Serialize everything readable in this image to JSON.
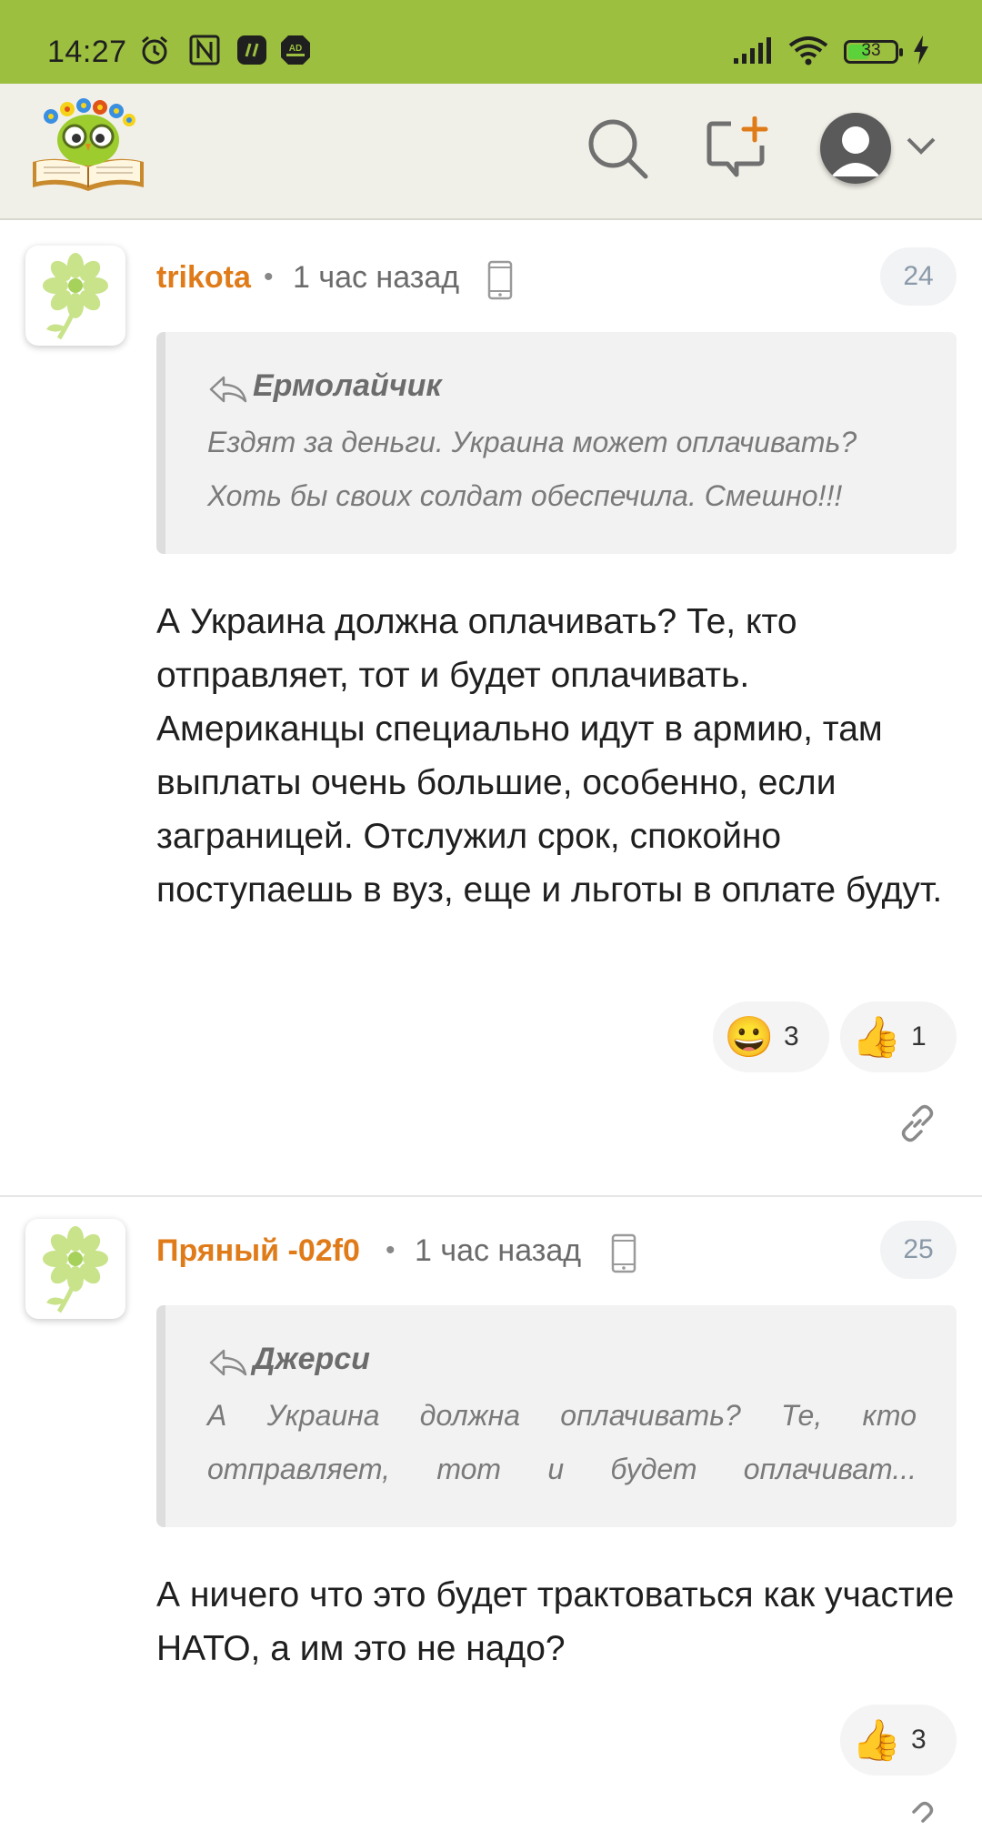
{
  "status_bar": {
    "time": "14:27",
    "battery": "33",
    "icons": [
      "alarm-icon",
      "nfc-icon",
      "app-icon",
      "adblocker-icon",
      "signal-icon",
      "wifi-icon",
      "battery-icon",
      "charging-icon"
    ],
    "ad_label": "AD"
  },
  "header": {
    "logo": "owl-book-logo",
    "search_icon": "search-icon",
    "new_post_icon": "new-comment-icon",
    "profile_icon": "user-avatar-icon",
    "dropdown_icon": "chevron-down-icon"
  },
  "colors": {
    "status_bar": "#9cbf3f",
    "header_bg": "#f1f0e8",
    "author": "#e07b1a",
    "quote_bg": "#f2f2f2"
  },
  "comments": [
    {
      "author": "trikota",
      "time": "1 час назад",
      "number": "24",
      "quote": {
        "author": "Ермолайчик",
        "line1": "Ездят за деньги. Украина может оплачивать?",
        "line2": "Хоть бы своих солдат обеспечила. Смешно!!!"
      },
      "text": "А Украина должна оплачивать? Те, кто отправляет, тот и будет оплачивать. Американцы специально идут в армию, там выплаты очень большие, особенно, если заграницей. Отслужил срок, спокойно поступаешь в вуз, еще и льготы в оплате будут.",
      "reactions": [
        {
          "emoji": "😀",
          "count": "3"
        },
        {
          "emoji": "👍",
          "count": "1"
        }
      ]
    },
    {
      "author": "Пряный -02f0",
      "time": "1 час назад",
      "number": "25",
      "quote": {
        "author": "Джерси",
        "line1": "А Украина должна оплачивать? Те, кто",
        "line2": "отправляет, тот и будет оплачиват..."
      },
      "text": "А ничего что это будет трактоваться как участие НАТО, а им это не надо?",
      "reactions": [
        {
          "emoji": "👍",
          "count": "3"
        }
      ]
    }
  ]
}
